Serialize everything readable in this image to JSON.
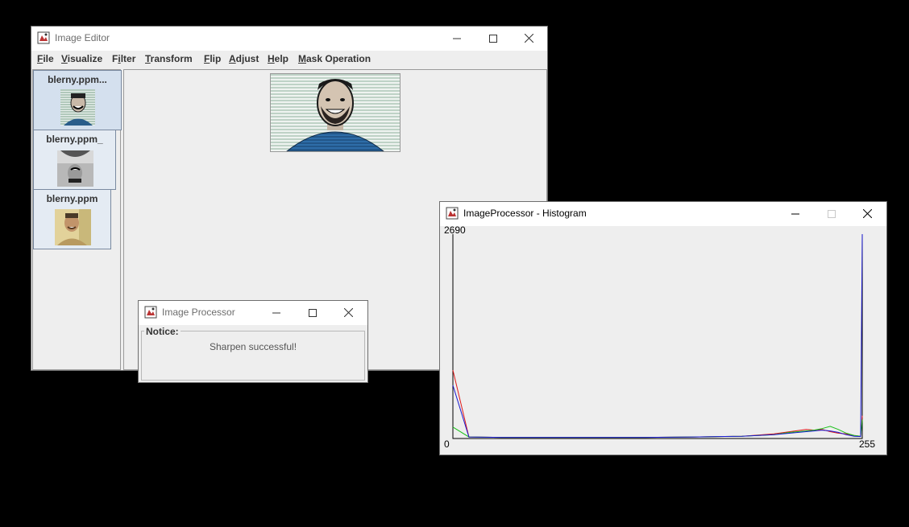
{
  "editor": {
    "title": "Image Editor",
    "icon": "java-coffee-icon",
    "menu": [
      {
        "label": "File",
        "mnemonic": "F",
        "rest": "ile"
      },
      {
        "label": "Visualize",
        "mnemonic": "V",
        "rest": "isualize"
      },
      {
        "label": "Filter",
        "mnemonic": "i",
        "pre": "F",
        "rest": "lter"
      },
      {
        "label": "Transform",
        "mnemonic": "T",
        "rest": "ransform"
      },
      {
        "label": "Flip",
        "mnemonic": "F",
        "rest": "lip"
      },
      {
        "label": "Adjust",
        "mnemonic": "A",
        "rest": "djust"
      },
      {
        "label": "Help",
        "mnemonic": "H",
        "rest": "elp"
      },
      {
        "label": "Mask Operation",
        "mnemonic": "M",
        "rest": "ask Operation"
      }
    ],
    "thumbnails": [
      {
        "label": "blerny.ppm...",
        "variant": "sharpened"
      },
      {
        "label": "blerny.ppm_",
        "variant": "flipped-grayscale"
      },
      {
        "label": "blerny.ppm",
        "variant": "original"
      }
    ]
  },
  "dialog": {
    "title": "Image Processor",
    "legend": "Notice:",
    "message": "Sharpen successful!"
  },
  "histogram": {
    "title": "ImageProcessor - Histogram",
    "y_max_label": "2690",
    "x_min_label": "0",
    "x_max_label": "255",
    "colors": {
      "red": "#e01818",
      "green": "#18c018",
      "blue": "#1818d0",
      "magenta": "#c018c0"
    }
  },
  "chart_data": {
    "type": "line",
    "x": [
      0,
      10,
      30,
      60,
      90,
      120,
      150,
      180,
      200,
      210,
      220,
      225,
      230,
      235,
      240,
      245,
      250,
      254,
      255
    ],
    "ylim": [
      0,
      2690
    ],
    "xlim": [
      0,
      255
    ],
    "series": [
      {
        "values": [
          900,
          20,
          15,
          15,
          15,
          15,
          20,
          30,
          60,
          90,
          120,
          110,
          120,
          90,
          70,
          60,
          40,
          30,
          300
        ]
      },
      {
        "values": [
          150,
          20,
          15,
          15,
          15,
          15,
          20,
          30,
          50,
          80,
          100,
          110,
          130,
          160,
          120,
          70,
          40,
          30,
          250
        ]
      },
      {
        "values": [
          700,
          20,
          15,
          15,
          15,
          15,
          20,
          30,
          50,
          70,
          90,
          100,
          110,
          100,
          80,
          50,
          30,
          25,
          2690
        ]
      }
    ]
  }
}
